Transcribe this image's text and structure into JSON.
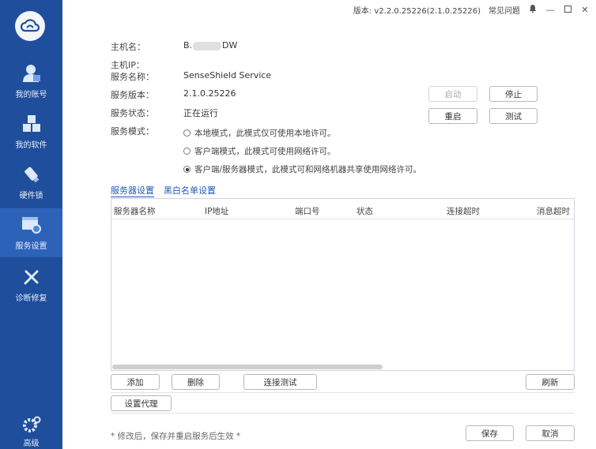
{
  "titlebar": {
    "version": "版本: v2.2.0.25226(2.1.0.25226)",
    "faq": "常见问题"
  },
  "sidebar": {
    "items": [
      {
        "label": "我的账号",
        "icon": "user-icon"
      },
      {
        "label": "我的软件",
        "icon": "cubes-icon"
      },
      {
        "label": "硬件锁",
        "icon": "usb-key-icon"
      },
      {
        "label": "服务设置",
        "icon": "service-settings-icon",
        "active": true
      },
      {
        "label": "诊断修复",
        "icon": "repair-tool-icon"
      }
    ],
    "bottom_label": "高级"
  },
  "info": {
    "host_label": "主机名：",
    "host_value_a": "B.",
    "host_value_b": "DW",
    "ip_label": "主机IP：",
    "svc_name_label": "服务名称：",
    "svc_name_value": "SenseShield Service",
    "svc_ver_label": "服务版本：",
    "svc_ver_value": "2.1.0.25226",
    "svc_status_label": "服务状态：",
    "svc_status_value": "正在运行",
    "svc_mode_label": "服务模式："
  },
  "modes": [
    {
      "label": "本地模式，此模式仅可使用本地许可。",
      "selected": false
    },
    {
      "label": "客户端模式，此模式可使用网络许可。",
      "selected": false
    },
    {
      "label": "客户端/服务器模式，此模式可和网络机器共享使用网络许可。",
      "selected": true
    }
  ],
  "buttons": {
    "start": "启动",
    "stop": "停止",
    "restart": "重启",
    "test": "测试",
    "add": "添加",
    "delete": "删除",
    "conn_test": "连接测试",
    "refresh": "刷新",
    "proxy": "设置代理",
    "save": "保存",
    "cancel": "取消"
  },
  "links": {
    "server": "服务器设置",
    "blacklist": "黑白名单设置"
  },
  "table": {
    "columns": [
      "服务器名称",
      "IP地址",
      "端口号",
      "状态",
      "连接超时",
      "消息超时"
    ],
    "rows": []
  },
  "note": "* 修改后，保存并重启服务后生效 *",
  "colors": {
    "sidebar": "#1f4e9c",
    "sidebar_active": "#2c63b8",
    "link": "#1f5bbf"
  }
}
